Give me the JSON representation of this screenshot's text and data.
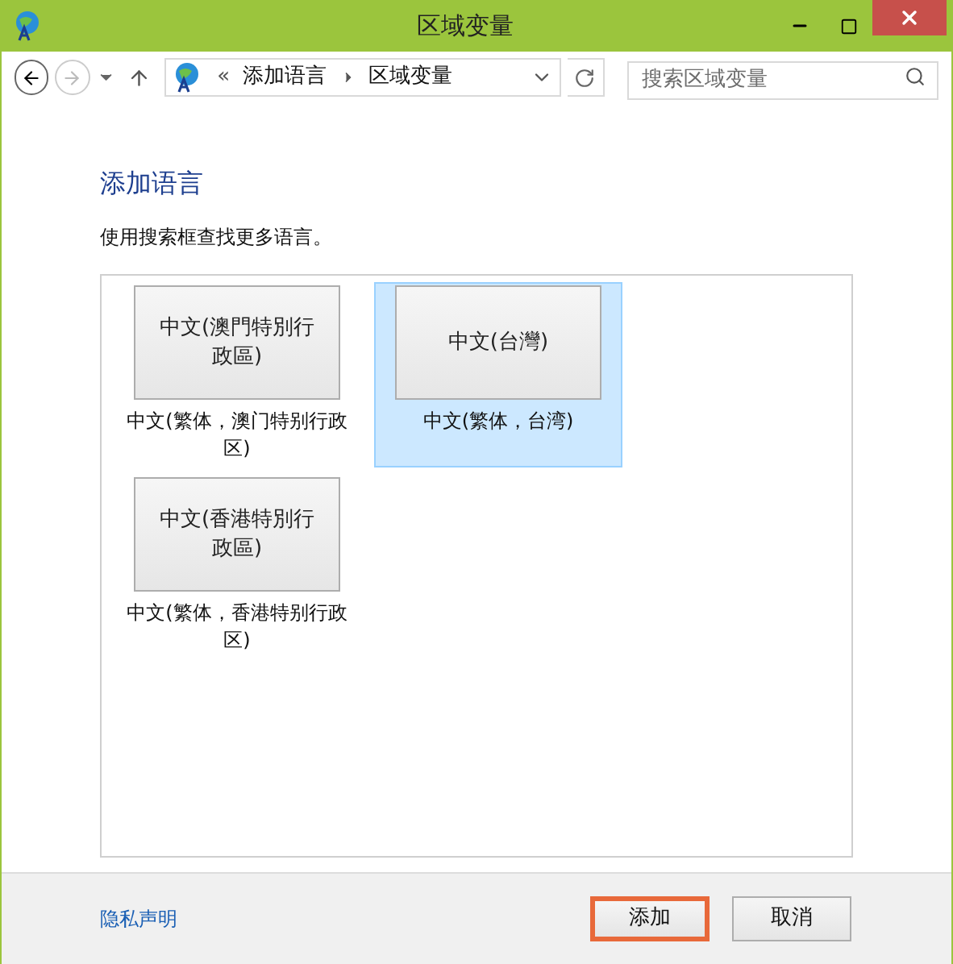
{
  "window": {
    "title": "区域变量"
  },
  "address": {
    "overflow": "«",
    "crumbs": [
      "添加语言",
      "区域变量"
    ]
  },
  "search": {
    "placeholder": "搜索区域变量"
  },
  "heading": "添加语言",
  "description": "使用搜索框查找更多语言。",
  "languages": [
    {
      "name": "中文(澳門特別行政區)",
      "label": "中文(繁体，澳门特别行政区)",
      "selected": false
    },
    {
      "name": "中文(台灣)",
      "label": "中文(繁体，台湾)",
      "selected": true
    },
    {
      "name": "中文(香港特別行政區)",
      "label": "中文(繁体，香港特别行政区)",
      "selected": false
    }
  ],
  "privacy_link": "隐私声明",
  "buttons": [
    {
      "label": "添加",
      "highlighted": true
    },
    {
      "label": "取消",
      "highlighted": false
    }
  ]
}
